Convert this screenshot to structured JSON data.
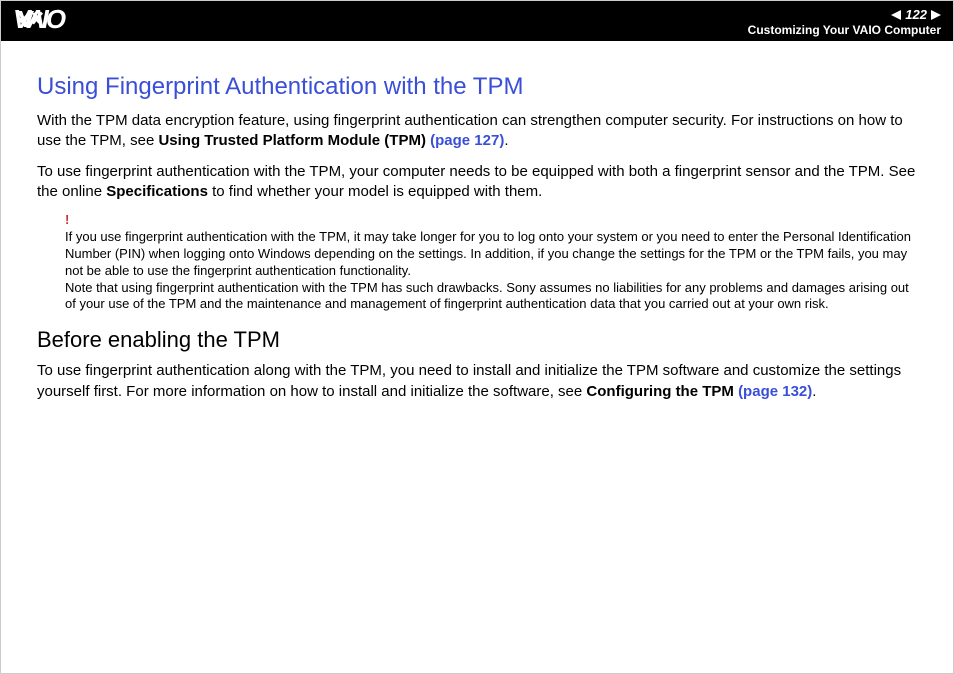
{
  "header": {
    "page_number": "122",
    "section": "Customizing Your VAIO Computer"
  },
  "content": {
    "title": "Using Fingerprint Authentication with the TPM",
    "para1_a": "With the TPM data encryption feature, using fingerprint authentication can strengthen computer security. For instructions on how to use the TPM, see ",
    "para1_bold": "Using Trusted Platform Module (TPM) ",
    "para1_link": "(page 127)",
    "para1_end": ".",
    "para2_a": "To use fingerprint authentication with the TPM, your computer needs to be equipped with both a fingerprint sensor and the TPM. See the online ",
    "para2_bold": "Specifications",
    "para2_b": " to find whether your model is equipped with them.",
    "note_icon": "!",
    "note1": "If you use fingerprint authentication with the TPM, it may take longer for you to log onto your system or you need to enter the Personal Identification Number (PIN) when logging onto Windows depending on the settings. In addition, if you change the settings for the TPM or the TPM fails, you may not be able to use the fingerprint authentication functionality.",
    "note2": "Note that using fingerprint authentication with the TPM has such drawbacks. Sony assumes no liabilities for any problems and damages arising out of your use of the TPM and the maintenance and management of fingerprint authentication data that you carried out at your own risk.",
    "subtitle": "Before enabling the TPM",
    "para3_a": "To use fingerprint authentication along with the TPM, you need to install and initialize the TPM software and customize the settings yourself first. For more information on how to install and initialize the software, see ",
    "para3_bold": "Configuring the TPM ",
    "para3_link": "(page 132)",
    "para3_end": "."
  }
}
